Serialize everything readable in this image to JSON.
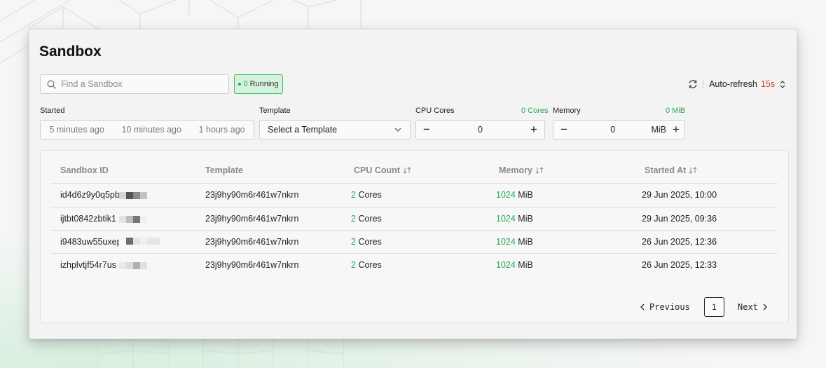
{
  "page": {
    "title": "Sandbox"
  },
  "search": {
    "placeholder": "Find a Sandbox",
    "value": ""
  },
  "running_badge": {
    "count": "0",
    "label": "Running"
  },
  "auto_refresh": {
    "label": "Auto-refresh",
    "interval": "15s"
  },
  "filters": {
    "started": {
      "label": "Started",
      "options": [
        "5 minutes ago",
        "10 minutes ago",
        "1 hours ago"
      ]
    },
    "template": {
      "label": "Template",
      "placeholder": "Select a Template"
    },
    "cpu": {
      "label": "CPU Cores",
      "summary": "0 Cores",
      "value": "0"
    },
    "memory": {
      "label": "Memory",
      "summary": "0 MiB",
      "value": "0",
      "unit": "MiB"
    }
  },
  "table": {
    "columns": [
      "Sandbox ID",
      "Template",
      "CPU Count",
      "Memory",
      "Started At"
    ],
    "rows": [
      {
        "id": "id4d6z9y0q5pb",
        "template": "23j9hy90m6r461w7nkrn",
        "cpu": "2",
        "cpu_unit": "Cores",
        "memory": "1024",
        "memory_unit": "MiB",
        "started": "29 Jun 2025, 10:00"
      },
      {
        "id": "ijtbt0842zbtik1",
        "template": "23j9hy90m6r461w7nkrn",
        "cpu": "2",
        "cpu_unit": "Cores",
        "memory": "1024",
        "memory_unit": "MiB",
        "started": "29 Jun 2025, 09:36"
      },
      {
        "id": "i9483uw55uxep",
        "template": "23j9hy90m6r461w7nkrn",
        "cpu": "2",
        "cpu_unit": "Cores",
        "memory": "1024",
        "memory_unit": "MiB",
        "started": "26 Jun 2025, 12:36"
      },
      {
        "id": "izhplvtjf54r7us",
        "template": "23j9hy90m6r461w7nkrn",
        "cpu": "2",
        "cpu_unit": "Cores",
        "memory": "1024",
        "memory_unit": "MiB",
        "started": "26 Jun 2025, 12:33"
      }
    ]
  },
  "pagination": {
    "previous": "Previous",
    "current_page": "1",
    "next": "Next"
  },
  "colors": {
    "accent_green": "#2aa653",
    "refresh_red": "#d83a3a",
    "badge_bg": "#d5f2dd"
  }
}
